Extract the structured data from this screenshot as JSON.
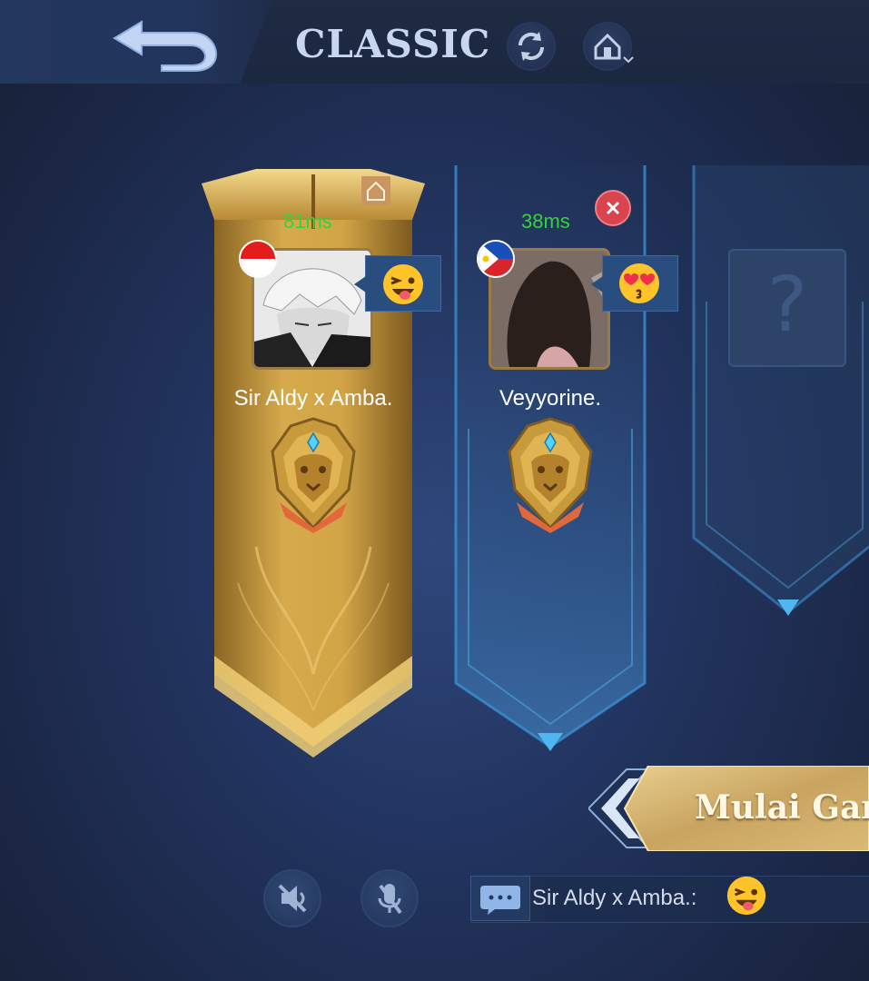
{
  "header": {
    "title": "CLASSIC"
  },
  "players": [
    {
      "name": "Sir Aldy x Amba.",
      "ping": "81ms",
      "flag": "indonesia-flag",
      "emote": "winking-tongue-emoji",
      "is_host": true,
      "rank_icon": "lion-rank-badge"
    },
    {
      "name": "Veyyorine.",
      "ping": "38ms",
      "flag": "philippines-flag",
      "emote": "heart-eyes-emoji",
      "is_host": false,
      "rank_icon": "lion-rank-badge"
    }
  ],
  "empty_slot": {
    "placeholder": "?"
  },
  "start_button": {
    "label": "Mulai Gam"
  },
  "chat": {
    "last_message": "Sir Aldy x Amba.:",
    "last_emote": "winking-tongue-emoji"
  },
  "colors": {
    "ping_green": "#33d33b",
    "gold": "#d8ad4e",
    "slot_blue": "#3c8fd0"
  }
}
